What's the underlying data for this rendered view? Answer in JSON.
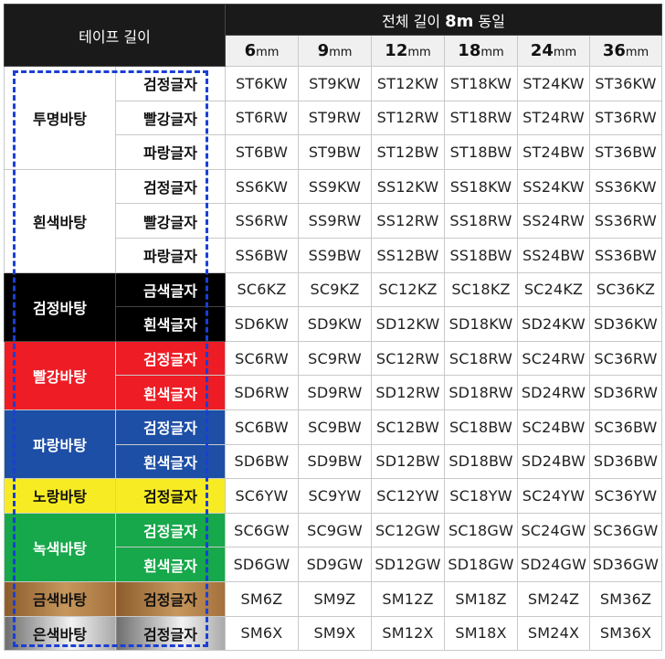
{
  "header": {
    "tape_length_label": "테이프 길이",
    "all_length_prefix": "전체 길이 ",
    "all_length_value": "8m",
    "all_length_suffix": " 동일"
  },
  "widths": [
    {
      "num": "6",
      "unit": "mm"
    },
    {
      "num": "9",
      "unit": "mm"
    },
    {
      "num": "12",
      "unit": "mm"
    },
    {
      "num": "18",
      "unit": "mm"
    },
    {
      "num": "24",
      "unit": "mm"
    },
    {
      "num": "36",
      "unit": "mm"
    }
  ],
  "groups": [
    {
      "background": "투명바탕",
      "bg_class": "bg-clear",
      "rows": [
        {
          "text_color": "검정글자",
          "text_class": "c-black",
          "cell_class": "bg-clear",
          "codes": [
            "ST6KW",
            "ST9KW",
            "ST12KW",
            "ST18KW",
            "ST24KW",
            "ST36KW"
          ]
        },
        {
          "text_color": "빨강글자",
          "text_class": "c-red",
          "cell_class": "bg-clear",
          "codes": [
            "ST6RW",
            "ST9RW",
            "ST12RW",
            "ST18RW",
            "ST24RW",
            "ST36RW"
          ]
        },
        {
          "text_color": "파랑글자",
          "text_class": "c-blue",
          "cell_class": "bg-clear",
          "codes": [
            "ST6BW",
            "ST9BW",
            "ST12BW",
            "ST18BW",
            "ST24BW",
            "ST36BW"
          ]
        }
      ]
    },
    {
      "background": "흰색바탕",
      "bg_class": "bg-white",
      "rows": [
        {
          "text_color": "검정글자",
          "text_class": "c-black",
          "cell_class": "bg-white",
          "codes": [
            "SS6KW",
            "SS9KW",
            "SS12KW",
            "SS18KW",
            "SS24KW",
            "SS36KW"
          ]
        },
        {
          "text_color": "빨강글자",
          "text_class": "c-red",
          "cell_class": "bg-white",
          "codes": [
            "SS6RW",
            "SS9RW",
            "SS12RW",
            "SS18RW",
            "SS24RW",
            "SS36RW"
          ]
        },
        {
          "text_color": "파랑글자",
          "text_class": "c-blue",
          "cell_class": "bg-white",
          "codes": [
            "SS6BW",
            "SS9BW",
            "SS12BW",
            "SS18BW",
            "SS24BW",
            "SS36BW"
          ]
        }
      ]
    },
    {
      "background": "검정바탕",
      "bg_class": "bg-blk",
      "rows": [
        {
          "text_color": "금색글자",
          "text_class": "c-gold",
          "cell_class": "bg-blk",
          "codes": [
            "SC6KZ",
            "SC9KZ",
            "SC12KZ",
            "SC18KZ",
            "SC24KZ",
            "SC36KZ"
          ]
        },
        {
          "text_color": "흰색글자",
          "text_class": "c-white",
          "cell_class": "bg-blk",
          "codes": [
            "SD6KW",
            "SD9KW",
            "SD12KW",
            "SD18KW",
            "SD24KW",
            "SD36KW"
          ]
        }
      ]
    },
    {
      "background": "빨강바탕",
      "bg_class": "bg-red",
      "rows": [
        {
          "text_color": "검정글자",
          "text_class": "c-black",
          "cell_class": "bg-red",
          "codes": [
            "SC6RW",
            "SC9RW",
            "SC12RW",
            "SC18RW",
            "SC24RW",
            "SC36RW"
          ]
        },
        {
          "text_color": "흰색글자",
          "text_class": "c-white",
          "cell_class": "bg-red",
          "codes": [
            "SD6RW",
            "SD9RW",
            "SD12RW",
            "SD18RW",
            "SD24RW",
            "SD36RW"
          ]
        }
      ]
    },
    {
      "background": "파랑바탕",
      "bg_class": "bg-blu",
      "rows": [
        {
          "text_color": "검정글자",
          "text_class": "c-black",
          "cell_class": "bg-blu",
          "codes": [
            "SC6BW",
            "SC9BW",
            "SC12BW",
            "SC18BW",
            "SC24BW",
            "SC36BW"
          ]
        },
        {
          "text_color": "흰색글자",
          "text_class": "c-white",
          "cell_class": "bg-blu",
          "codes": [
            "SD6BW",
            "SD9BW",
            "SD12BW",
            "SD18BW",
            "SD24BW",
            "SD36BW"
          ]
        }
      ]
    },
    {
      "background": "노랑바탕",
      "bg_class": "bg-yel",
      "rows": [
        {
          "text_color": "검정글자",
          "text_class": "c-black",
          "cell_class": "bg-yel",
          "codes": [
            "SC6YW",
            "SC9YW",
            "SC12YW",
            "SC18YW",
            "SC24YW",
            "SC36YW"
          ]
        }
      ]
    },
    {
      "background": "녹색바탕",
      "bg_class": "bg-grn",
      "rows": [
        {
          "text_color": "검정글자",
          "text_class": "c-black",
          "cell_class": "bg-grn",
          "codes": [
            "SC6GW",
            "SC9GW",
            "SC12GW",
            "SC18GW",
            "SC24GW",
            "SC36GW"
          ]
        },
        {
          "text_color": "흰색글자",
          "text_class": "c-white",
          "cell_class": "bg-grn",
          "codes": [
            "SD6GW",
            "SD9GW",
            "SD12GW",
            "SD18GW",
            "SD24GW",
            "SD36GW"
          ]
        }
      ]
    },
    {
      "background": "금색바탕",
      "bg_class": "bg-gld",
      "rows": [
        {
          "text_color": "검정글자",
          "text_class": "c-black",
          "cell_class": "bg-gld",
          "codes": [
            "SM6Z",
            "SM9Z",
            "SM12Z",
            "SM18Z",
            "SM24Z",
            "SM36Z"
          ]
        }
      ]
    },
    {
      "background": "은색바탕",
      "bg_class": "bg-slv",
      "rows": [
        {
          "text_color": "검정글자",
          "text_class": "c-black",
          "cell_class": "bg-slv",
          "codes": [
            "SM6X",
            "SM9X",
            "SM12X",
            "SM18X",
            "SM24X",
            "SM36X"
          ]
        }
      ]
    }
  ],
  "colors": {
    "highlight_border": "#1a3fd6",
    "header_bg": "#1a1a1a",
    "subheader_bg": "#f0f0f0",
    "grid": "#c9c9c9"
  }
}
